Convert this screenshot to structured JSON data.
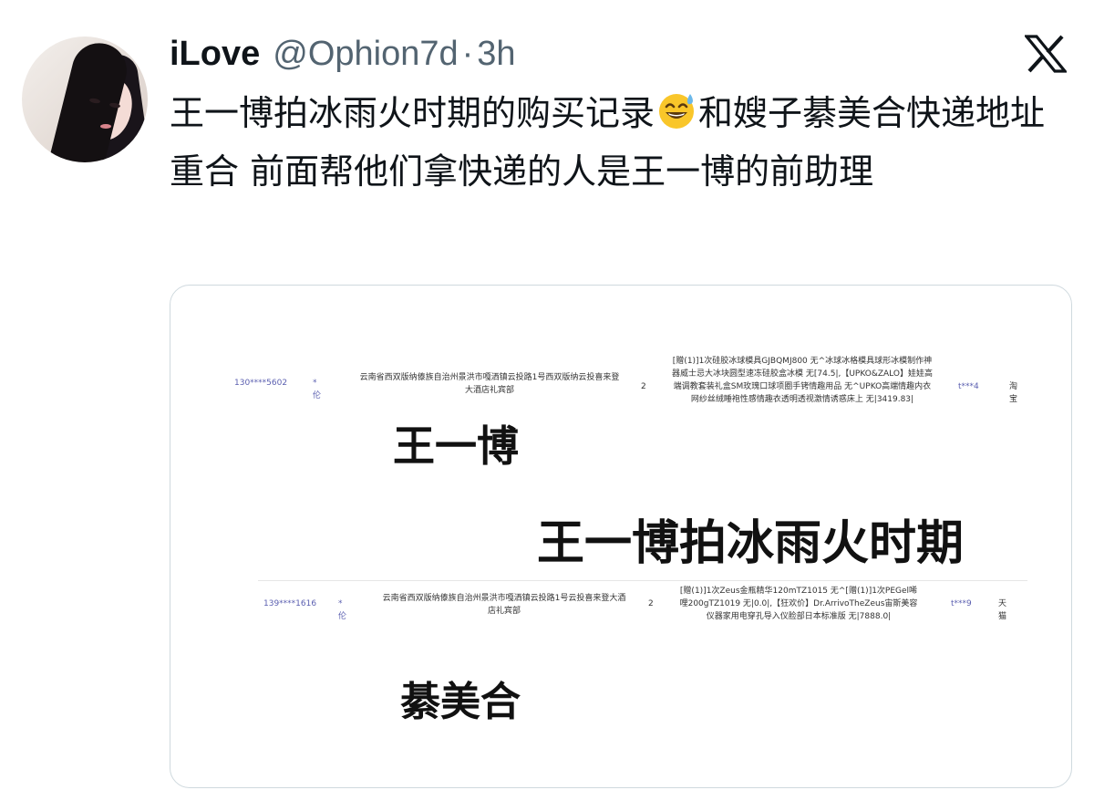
{
  "tweet": {
    "display_name": "iLove",
    "handle": "@Ophion7d",
    "separator": "·",
    "time": "3h",
    "text_before_emoji": "王一博拍冰雨火时期的购买记录",
    "emoji": "sweat-smile-emoji",
    "text_after_emoji": "和嫂子綦美合快递地址重合 前面帮他们拿快递的人是王一博的前助理"
  },
  "media": {
    "rows": [
      {
        "phone": "130****5602",
        "receiver": "*伦",
        "address": "云南省西双版纳傣族自治州景洪市嘎洒镇云投路1号西双版纳云投喜来登大酒店礼宾部",
        "quantity": "2",
        "items": "[赠(1)]1次硅胶冰球模具GJBQMJ800 无^冰球冰格模具球形冰模制作神器威士忌大冰块圆型速冻硅胶盒冰模 无[74.5|,【UPKO&ZALO】娃娃高端调教套装礼盒SM玫瑰口球项圈手铐情趣用品 无^UPKO高端情趣内衣网纱丝绒睡袍性感情趣衣透明透视激情诱惑床上 无|3419.83|",
        "seller": "t***4",
        "platform": "淘宝"
      },
      {
        "phone": "139****1616",
        "receiver": "*伦",
        "address": "云南省西双版纳傣族自治州景洪市嘎洒镇云投路1号云投喜来登大酒店礼宾部",
        "quantity": "2",
        "items": "[赠(1)]1次Zeus金瓶精华120mTZ1015 无^[赠(1)]1次PEGel唏哩200gTZ1019 无|0.0|,【狂欢价】Dr.ArrivoTheZeus宙斯美容仪器家用电穿孔导入仪脸部日本标准版 无|7888.0|",
        "seller": "t***9",
        "platform": "天猫"
      }
    ],
    "overlay_label_1": "王一博",
    "overlay_label_2": "王一博拍冰雨火时期",
    "overlay_label_3": "綦美合"
  }
}
